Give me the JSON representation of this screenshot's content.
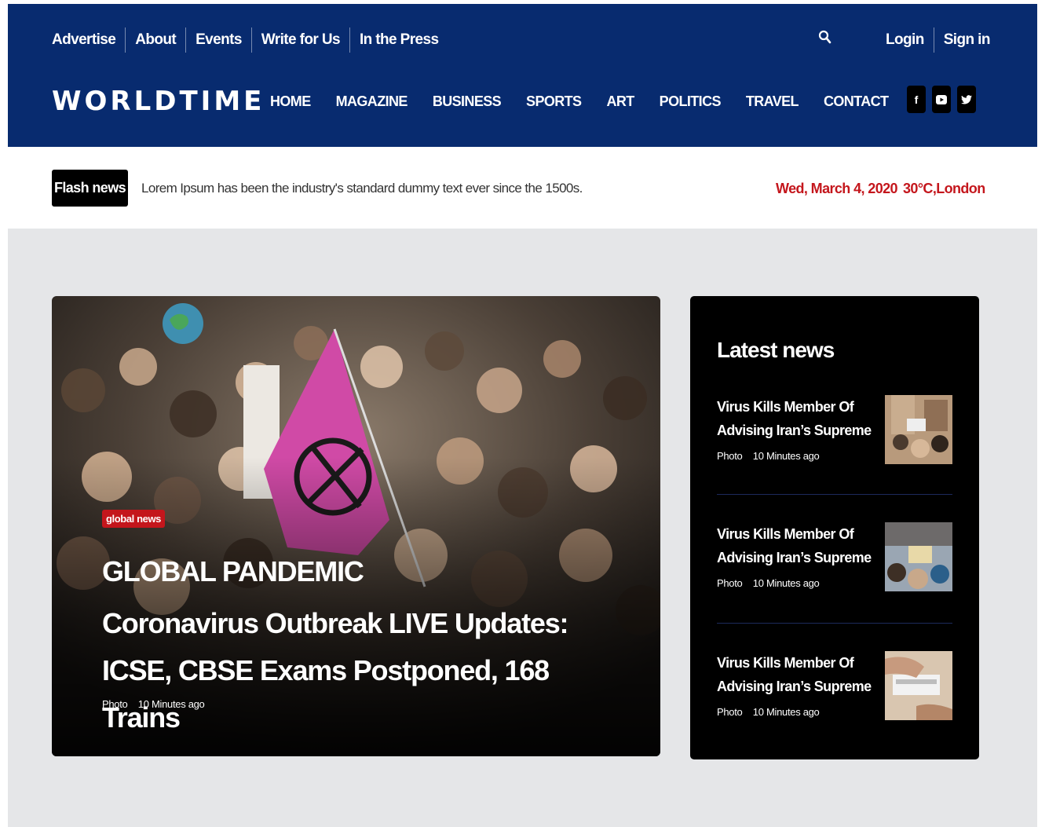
{
  "header": {
    "top_links": [
      "Advertise",
      "About",
      "Events",
      "Write for Us",
      "In the Press"
    ],
    "auth": {
      "login": "Login",
      "signin": "Sign in"
    },
    "logo": "WORLDTIME",
    "nav": [
      "HOME",
      "MAGAZINE",
      "BUSINESS",
      "SPORTS",
      "ART",
      "POLITICS",
      "TRAVEL",
      "CONTACT"
    ],
    "social": [
      {
        "icon": "facebook-icon",
        "glyph": "f"
      },
      {
        "icon": "youtube-icon",
        "glyph": "▶"
      },
      {
        "icon": "twitter-icon",
        "glyph": "t"
      }
    ],
    "search_icon": "search-icon",
    "color": "#082b6f"
  },
  "flash": {
    "label": "Flash news",
    "text": "Lorem Ipsum has been the industry's standard dummy text ever since the 1500s.",
    "date": "Wed, March 4, 2020",
    "weather": "30°C,London",
    "accent": "#c4161c"
  },
  "hero": {
    "tag": "global news",
    "title_line1": "GLOBAL PANDEMIC",
    "title_line2": "Coronavirus Outbreak LIVE Updates: ICSE, CBSE Exams Postponed, 168 Trains",
    "meta_type": "Photo",
    "meta_time": "10 Minutes ago"
  },
  "latest": {
    "heading": "Latest news",
    "items": [
      {
        "title": "Virus Kills Member Of Advising Iran’s Supreme",
        "type": "Photo",
        "time": "10 Minutes ago"
      },
      {
        "title": "Virus Kills Member Of Advising Iran’s Supreme",
        "type": "Photo",
        "time": "10 Minutes ago"
      },
      {
        "title": "Virus Kills Member Of Advising Iran’s Supreme",
        "type": "Photo",
        "time": "10 Minutes ago"
      }
    ]
  }
}
